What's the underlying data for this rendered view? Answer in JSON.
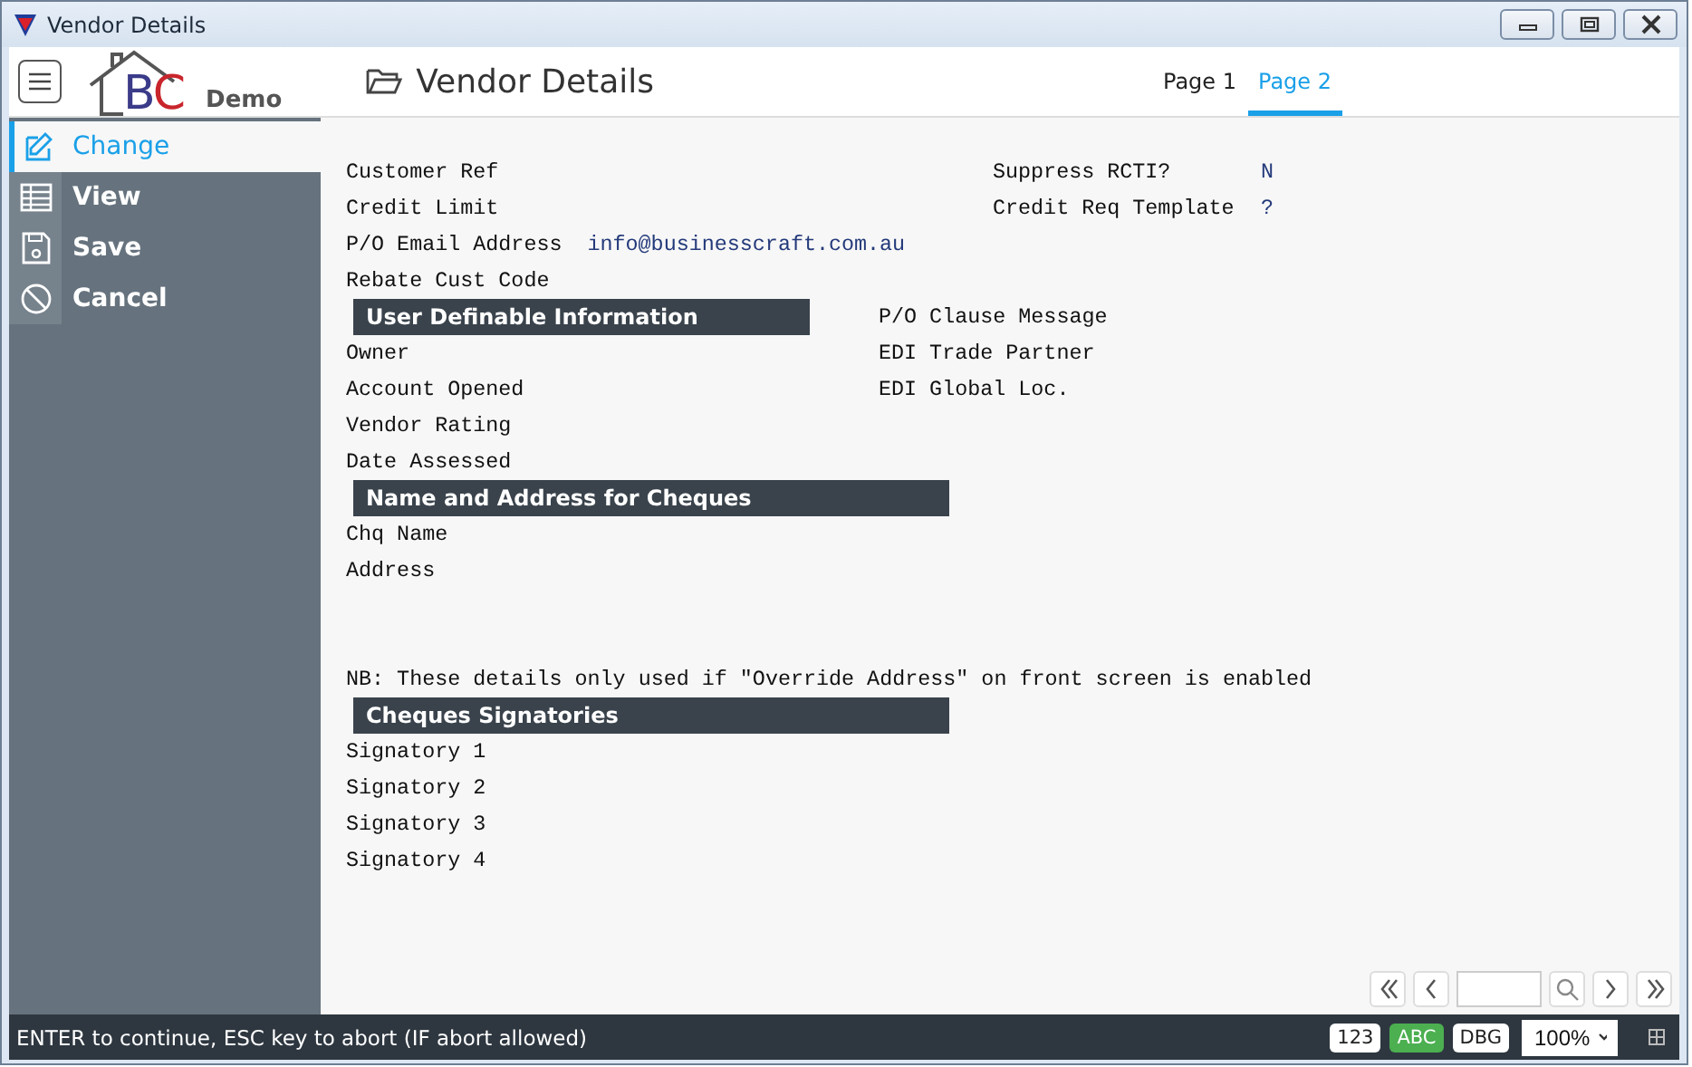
{
  "window": {
    "title": "Vendor Details"
  },
  "header": {
    "logo_text": "BC",
    "edition": "Demo",
    "title": "Vendor Details"
  },
  "tabs": [
    {
      "label": "Page 1",
      "selected": false
    },
    {
      "label": "Page 2",
      "selected": true
    }
  ],
  "sidebar": {
    "items": [
      {
        "label": "Change",
        "selected": true
      },
      {
        "label": "View",
        "selected": false
      },
      {
        "label": "Save",
        "selected": false
      },
      {
        "label": "Cancel",
        "selected": false
      }
    ]
  },
  "form": {
    "rows": [
      {
        "kind": "field",
        "label": "Customer Ref",
        "right_label": "Suppress RCTI?",
        "right_value": "N"
      },
      {
        "kind": "field",
        "label": "Credit Limit",
        "right_label": "Credit Req Template",
        "right_value": "?"
      },
      {
        "kind": "field",
        "label": "P/O Email Address",
        "value": "info@businesscraft.com.au"
      },
      {
        "kind": "field",
        "label": "Rebate Cust Code"
      },
      {
        "kind": "header",
        "text": "User Definable Information",
        "side_label": "P/O Clause Message"
      },
      {
        "kind": "field",
        "label": "Owner",
        "side_label": "EDI Trade Partner"
      },
      {
        "kind": "field",
        "label": "Account Opened",
        "side_label": "EDI Global Loc."
      },
      {
        "kind": "field",
        "label": "Vendor Rating"
      },
      {
        "kind": "field",
        "label": "Date Assessed"
      },
      {
        "kind": "header",
        "text": "Name and Address for Cheques"
      },
      {
        "kind": "field",
        "label": "Chq Name"
      },
      {
        "kind": "field",
        "label": "Address"
      },
      {
        "kind": "blank"
      },
      {
        "kind": "blank"
      },
      {
        "kind": "note",
        "text": "NB: These details only used if \"Override Address\" on front screen is enabled"
      },
      {
        "kind": "header",
        "text": "Cheques Signatories"
      },
      {
        "kind": "field",
        "label": "Signatory 1"
      },
      {
        "kind": "field",
        "label": "Signatory 2"
      },
      {
        "kind": "field",
        "label": "Signatory 3"
      },
      {
        "kind": "field",
        "label": "Signatory 4"
      }
    ]
  },
  "status_bar": {
    "message": "ENTER to continue, ESC key to abort (IF abort allowed)",
    "modes": [
      {
        "label": "123",
        "selected": false
      },
      {
        "label": "ABC",
        "selected": true
      },
      {
        "label": "DBG",
        "selected": false
      }
    ],
    "zoom": "100%"
  }
}
